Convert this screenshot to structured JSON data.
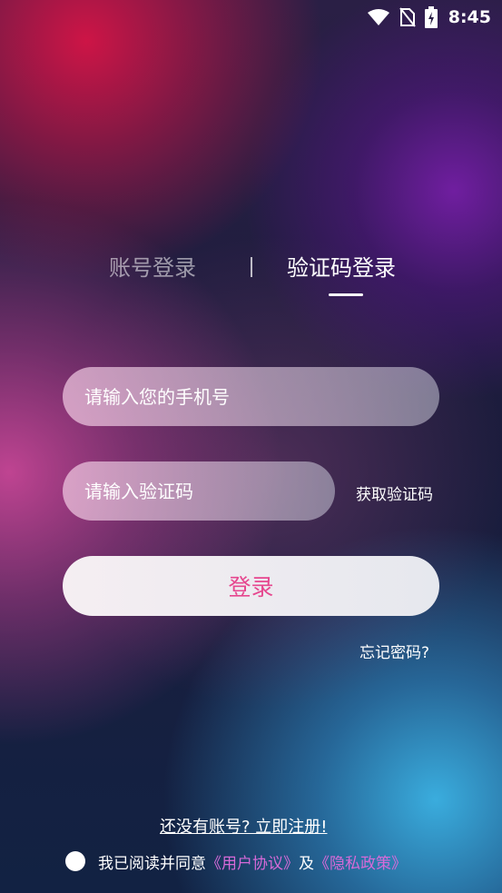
{
  "status_bar": {
    "time": "8:45",
    "icons": [
      "wifi-icon",
      "no-sim-icon",
      "battery-charging-icon"
    ]
  },
  "tabs": {
    "account_login": "账号登录",
    "divider": "|",
    "code_login": "验证码登录",
    "active": "code_login"
  },
  "form": {
    "phone_placeholder": "请输入您的手机号",
    "code_placeholder": "请输入验证码",
    "get_code_label": "获取验证码",
    "login_label": "登录",
    "forgot_label": "忘记密码?"
  },
  "footer": {
    "register_label": "还没有账号? 立即注册!",
    "agree_text": "我已阅读并同意",
    "user_agreement": "《用户协议》",
    "and_text": "及",
    "privacy_policy": "《隐私政策》"
  },
  "colors": {
    "accent_pink": "#e6478f",
    "link_purple": "#d66ad8"
  }
}
